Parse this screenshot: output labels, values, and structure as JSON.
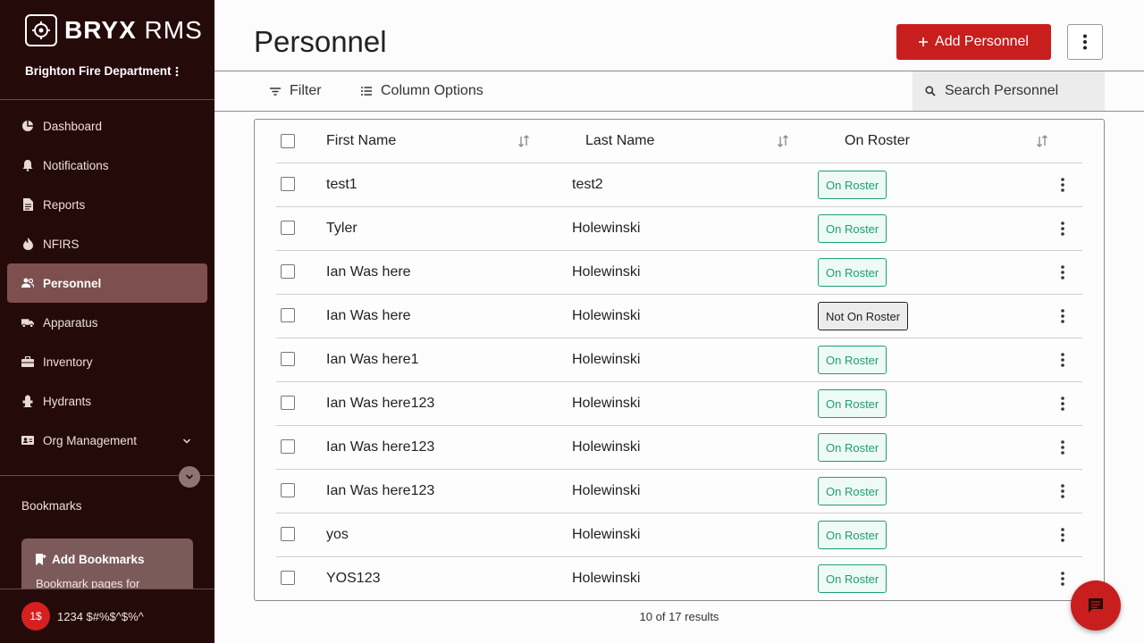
{
  "brand": {
    "name_bold": "BRYX",
    "name_light": "RMS",
    "icon": "bryx-logo-icon"
  },
  "department": {
    "name": "Brighton Fire Department",
    "menu_icon": "vertical-dots-icon"
  },
  "sidebar": {
    "items": [
      {
        "label": "Dashboard",
        "icon": "dashboard-icon"
      },
      {
        "label": "Notifications",
        "icon": "bell-icon"
      },
      {
        "label": "Reports",
        "icon": "document-icon"
      },
      {
        "label": "NFIRS",
        "icon": "flame-icon"
      },
      {
        "label": "Personnel",
        "icon": "people-icon",
        "active": true
      },
      {
        "label": "Apparatus",
        "icon": "truck-icon"
      },
      {
        "label": "Inventory",
        "icon": "briefcase-icon"
      },
      {
        "label": "Hydrants",
        "icon": "hydrant-icon"
      },
      {
        "label": "Org Management",
        "icon": "id-card-icon"
      }
    ],
    "bookmarks_label": "Bookmarks",
    "bookmark_card": {
      "title": "Add Bookmarks",
      "subtitle": "Bookmark pages for"
    },
    "user": {
      "avatar_text": "1$",
      "name": "1234 $#%$^$%^"
    }
  },
  "header": {
    "title": "Personnel",
    "add_button": "Add Personnel"
  },
  "toolbar": {
    "filter_label": "Filter",
    "column_options_label": "Column Options",
    "search_placeholder": "Search Personnel"
  },
  "table": {
    "columns": [
      "First Name",
      "Last Name",
      "On Roster"
    ],
    "rows": [
      {
        "first": "test1",
        "last": "test2",
        "status": "On Roster",
        "on": true
      },
      {
        "first": "Tyler",
        "last": "Holewinski",
        "status": "On Roster",
        "on": true
      },
      {
        "first": "Ian Was here",
        "last": "Holewinski",
        "status": "On Roster",
        "on": true
      },
      {
        "first": "Ian Was here",
        "last": "Holewinski",
        "status": "Not On Roster",
        "on": false
      },
      {
        "first": "Ian Was here1",
        "last": "Holewinski",
        "status": "On Roster",
        "on": true
      },
      {
        "first": "Ian Was here123",
        "last": "Holewinski",
        "status": "On Roster",
        "on": true
      },
      {
        "first": "Ian Was here123",
        "last": "Holewinski",
        "status": "On Roster",
        "on": true
      },
      {
        "first": "Ian Was here123",
        "last": "Holewinski",
        "status": "On Roster",
        "on": true
      },
      {
        "first": "yos",
        "last": "Holewinski",
        "status": "On Roster",
        "on": true
      },
      {
        "first": "YOS123",
        "last": "Holewinski",
        "status": "On Roster",
        "on": true
      }
    ],
    "results_text": "10 of 17 results"
  },
  "colors": {
    "sidebar_bg": "#250a0a",
    "accent_red": "#c81e1e",
    "on_roster_green": "#1f9e74",
    "active_nav": "#7d4f4f"
  }
}
